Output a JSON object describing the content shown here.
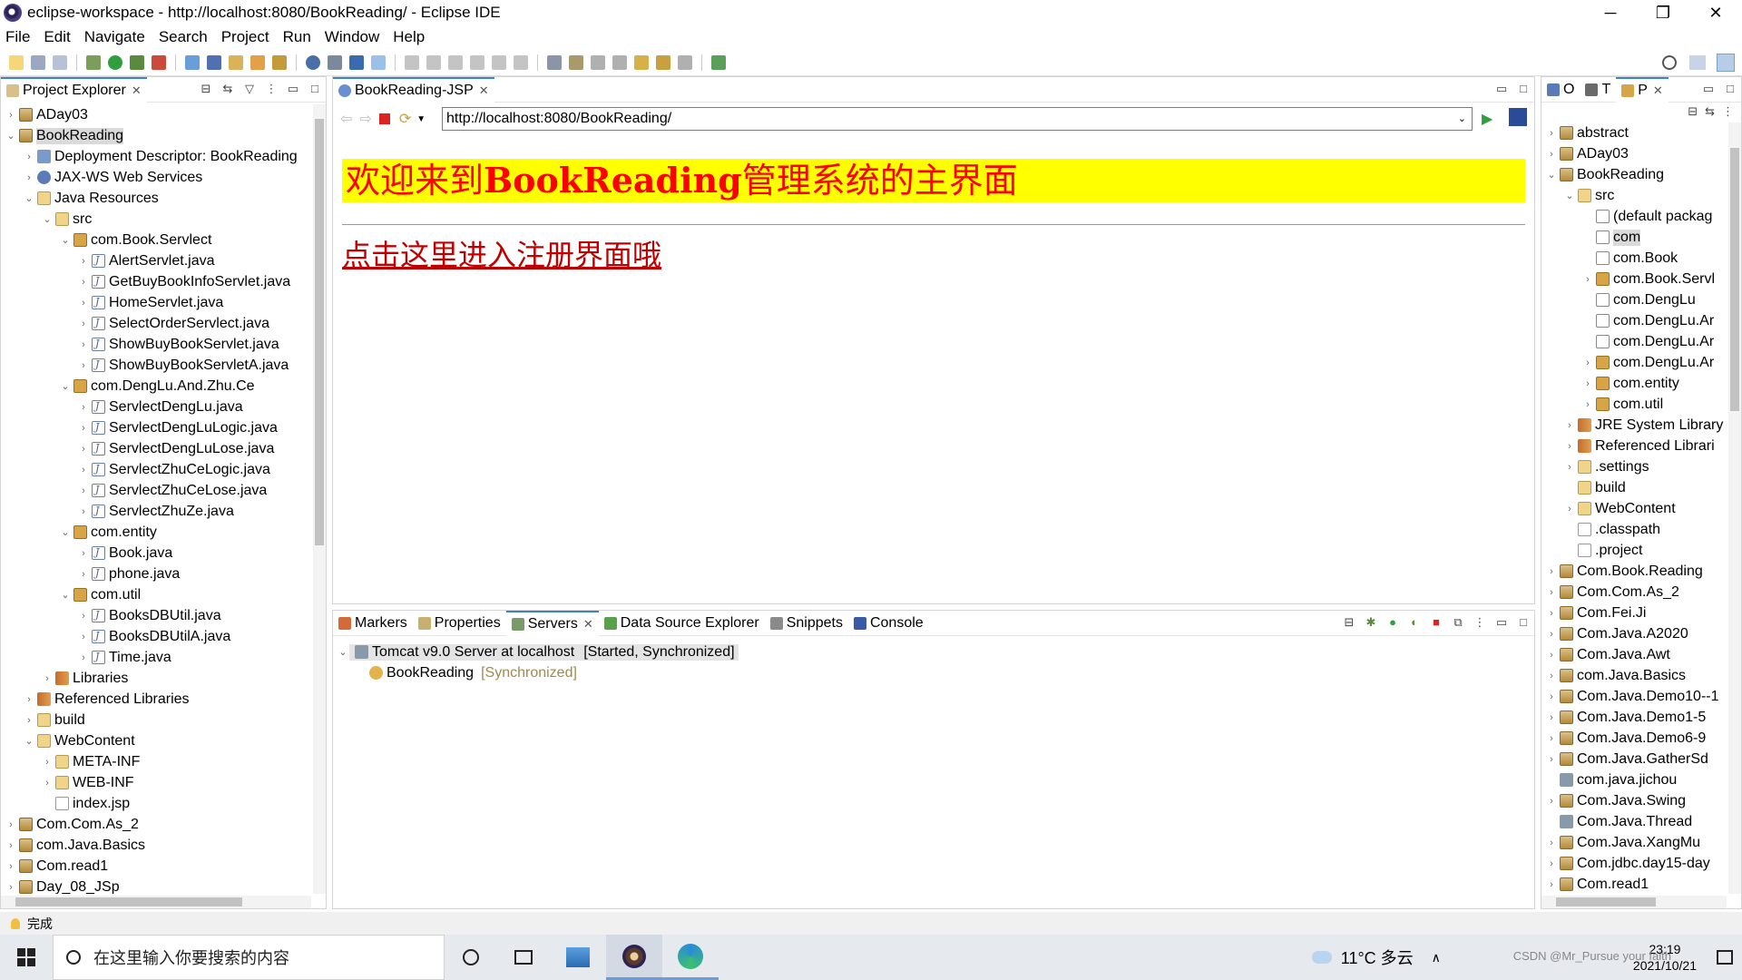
{
  "window": {
    "title": "eclipse-workspace - http://localhost:8080/BookReading/ - Eclipse IDE",
    "minimize": "─",
    "restore": "❐",
    "close": "✕"
  },
  "menu": [
    "File",
    "Edit",
    "Navigate",
    "Search",
    "Project",
    "Run",
    "Window",
    "Help"
  ],
  "project_explorer": {
    "tab_label": "Project Explorer",
    "rows": [
      {
        "label": "ADay03",
        "depth": 0,
        "tw": "›",
        "icon": "proj"
      },
      {
        "label": "BookReading",
        "depth": 0,
        "tw": "⌄",
        "icon": "proj",
        "sel": true
      },
      {
        "label": "Deployment Descriptor: BookReading",
        "depth": 1,
        "tw": "›",
        "icon": "dd"
      },
      {
        "label": "JAX-WS Web Services",
        "depth": 1,
        "tw": "›",
        "icon": "ws"
      },
      {
        "label": "Java Resources",
        "depth": 1,
        "tw": "⌄",
        "icon": "folder"
      },
      {
        "label": "src",
        "depth": 2,
        "tw": "⌄",
        "icon": "folder"
      },
      {
        "label": "com.Book.Servlect",
        "depth": 3,
        "tw": "⌄",
        "icon": "pkg"
      },
      {
        "label": "AlertServlet.java",
        "depth": 4,
        "tw": "›",
        "icon": "java"
      },
      {
        "label": "GetBuyBookInfoServlet.java",
        "depth": 4,
        "tw": "›",
        "icon": "java"
      },
      {
        "label": "HomeServlet.java",
        "depth": 4,
        "tw": "›",
        "icon": "java"
      },
      {
        "label": "SelectOrderServlect.java",
        "depth": 4,
        "tw": "›",
        "icon": "java"
      },
      {
        "label": "ShowBuyBookServlet.java",
        "depth": 4,
        "tw": "›",
        "icon": "java"
      },
      {
        "label": "ShowBuyBookServletA.java",
        "depth": 4,
        "tw": "›",
        "icon": "java"
      },
      {
        "label": "com.DengLu.And.Zhu.Ce",
        "depth": 3,
        "tw": "⌄",
        "icon": "pkg"
      },
      {
        "label": "ServlectDengLu.java",
        "depth": 4,
        "tw": "›",
        "icon": "java"
      },
      {
        "label": "ServlectDengLuLogic.java",
        "depth": 4,
        "tw": "›",
        "icon": "java"
      },
      {
        "label": "ServlectDengLuLose.java",
        "depth": 4,
        "tw": "›",
        "icon": "java"
      },
      {
        "label": "ServlectZhuCeLogic.java",
        "depth": 4,
        "tw": "›",
        "icon": "java"
      },
      {
        "label": "ServlectZhuCeLose.java",
        "depth": 4,
        "tw": "›",
        "icon": "java"
      },
      {
        "label": "ServlectZhuZe.java",
        "depth": 4,
        "tw": "›",
        "icon": "java"
      },
      {
        "label": "com.entity",
        "depth": 3,
        "tw": "⌄",
        "icon": "pkg"
      },
      {
        "label": "Book.java",
        "depth": 4,
        "tw": "›",
        "icon": "java"
      },
      {
        "label": "phone.java",
        "depth": 4,
        "tw": "›",
        "icon": "java"
      },
      {
        "label": "com.util",
        "depth": 3,
        "tw": "⌄",
        "icon": "pkg"
      },
      {
        "label": "BooksDBUtil.java",
        "depth": 4,
        "tw": "›",
        "icon": "java"
      },
      {
        "label": "BooksDBUtilA.java",
        "depth": 4,
        "tw": "›",
        "icon": "java"
      },
      {
        "label": "Time.java",
        "depth": 4,
        "tw": "›",
        "icon": "java"
      },
      {
        "label": "Libraries",
        "depth": 2,
        "tw": "›",
        "icon": "lib"
      },
      {
        "label": "Referenced Libraries",
        "depth": 1,
        "tw": "›",
        "icon": "lib"
      },
      {
        "label": "build",
        "depth": 1,
        "tw": "›",
        "icon": "folder"
      },
      {
        "label": "WebContent",
        "depth": 1,
        "tw": "⌄",
        "icon": "folder"
      },
      {
        "label": "META-INF",
        "depth": 2,
        "tw": "›",
        "icon": "folder"
      },
      {
        "label": "WEB-INF",
        "depth": 2,
        "tw": "›",
        "icon": "folder"
      },
      {
        "label": "index.jsp",
        "depth": 2,
        "tw": "",
        "icon": "file"
      },
      {
        "label": "Com.Com.As_2",
        "depth": 0,
        "tw": "›",
        "icon": "proj"
      },
      {
        "label": "com.Java.Basics",
        "depth": 0,
        "tw": "›",
        "icon": "proj"
      },
      {
        "label": "Com.read1",
        "depth": 0,
        "tw": "›",
        "icon": "proj"
      },
      {
        "label": "Day_08_JSp",
        "depth": 0,
        "tw": "›",
        "icon": "proj"
      }
    ]
  },
  "browser": {
    "tab_label": "BookReading-JSP",
    "url": "http://localhost:8080/BookReading/",
    "welcome_prefix": "欢迎来到",
    "welcome_bold": "BookReading",
    "welcome_suffix": "管理系统的主界面",
    "register_link": "点击这里进入注册界面哦"
  },
  "bottom_panel": {
    "tabs": [
      "Markers",
      "Properties",
      "Servers",
      "Data Source Explorer",
      "Snippets",
      "Console"
    ],
    "server_name": "Tomcat v9.0 Server at localhost",
    "server_status": "[Started, Synchronized]",
    "module_name": "BookReading",
    "module_status": "[Synchronized]"
  },
  "right_panel": {
    "tabs": [
      "O",
      "T",
      "P"
    ],
    "rows": [
      {
        "label": "abstract",
        "depth": 0,
        "tw": "›",
        "icon": "proj"
      },
      {
        "label": "ADay03",
        "depth": 0,
        "tw": "›",
        "icon": "proj"
      },
      {
        "label": "BookReading",
        "depth": 0,
        "tw": "⌄",
        "icon": "proj"
      },
      {
        "label": "src",
        "depth": 1,
        "tw": "⌄",
        "icon": "folder"
      },
      {
        "label": "(default packag",
        "depth": 2,
        "tw": "",
        "icon": "pkgempty"
      },
      {
        "label": "com",
        "depth": 2,
        "tw": "",
        "icon": "pkgempty",
        "sel": true
      },
      {
        "label": "com.Book",
        "depth": 2,
        "tw": "",
        "icon": "pkgempty"
      },
      {
        "label": "com.Book.Servl",
        "depth": 2,
        "tw": "›",
        "icon": "pkg"
      },
      {
        "label": "com.DengLu",
        "depth": 2,
        "tw": "",
        "icon": "pkgempty"
      },
      {
        "label": "com.DengLu.Ar",
        "depth": 2,
        "tw": "",
        "icon": "pkgempty"
      },
      {
        "label": "com.DengLu.Ar",
        "depth": 2,
        "tw": "",
        "icon": "pkgempty"
      },
      {
        "label": "com.DengLu.Ar",
        "depth": 2,
        "tw": "›",
        "icon": "pkg"
      },
      {
        "label": "com.entity",
        "depth": 2,
        "tw": "›",
        "icon": "pkg"
      },
      {
        "label": "com.util",
        "depth": 2,
        "tw": "›",
        "icon": "pkg"
      },
      {
        "label": "JRE System Library",
        "depth": 1,
        "tw": "›",
        "icon": "lib"
      },
      {
        "label": "Referenced Librari",
        "depth": 1,
        "tw": "›",
        "icon": "lib"
      },
      {
        "label": ".settings",
        "depth": 1,
        "tw": "›",
        "icon": "folder"
      },
      {
        "label": "build",
        "depth": 1,
        "tw": "",
        "icon": "folder"
      },
      {
        "label": "WebContent",
        "depth": 1,
        "tw": "›",
        "icon": "folder"
      },
      {
        "label": ".classpath",
        "depth": 1,
        "tw": "",
        "icon": "file"
      },
      {
        "label": ".project",
        "depth": 1,
        "tw": "",
        "icon": "file"
      },
      {
        "label": "Com.Book.Reading",
        "depth": 0,
        "tw": "›",
        "icon": "proj"
      },
      {
        "label": "Com.Com.As_2",
        "depth": 0,
        "tw": "›",
        "icon": "proj"
      },
      {
        "label": "Com.Fei.Ji",
        "depth": 0,
        "tw": "›",
        "icon": "proj"
      },
      {
        "label": "Com.Java.A2020",
        "depth": 0,
        "tw": "›",
        "icon": "proj"
      },
      {
        "label": "Com.Java.Awt",
        "depth": 0,
        "tw": "›",
        "icon": "proj"
      },
      {
        "label": "com.Java.Basics",
        "depth": 0,
        "tw": "›",
        "icon": "proj"
      },
      {
        "label": "Com.Java.Demo10--1",
        "depth": 0,
        "tw": "›",
        "icon": "proj"
      },
      {
        "label": "Com.Java.Demo1-5",
        "depth": 0,
        "tw": "›",
        "icon": "proj"
      },
      {
        "label": "Com.Java.Demo6-9",
        "depth": 0,
        "tw": "›",
        "icon": "proj"
      },
      {
        "label": "Com.Java.GatherSd",
        "depth": 0,
        "tw": "›",
        "icon": "proj"
      },
      {
        "label": "com.java.jichou",
        "depth": 0,
        "tw": "",
        "icon": "server"
      },
      {
        "label": "Com.Java.Swing",
        "depth": 0,
        "tw": "›",
        "icon": "proj"
      },
      {
        "label": "Com.Java.Thread",
        "depth": 0,
        "tw": "",
        "icon": "server"
      },
      {
        "label": "Com.Java.XangMu",
        "depth": 0,
        "tw": "›",
        "icon": "proj"
      },
      {
        "label": "Com.jdbc.day15-day",
        "depth": 0,
        "tw": "›",
        "icon": "proj"
      },
      {
        "label": "Com.read1",
        "depth": 0,
        "tw": "›",
        "icon": "proj"
      }
    ]
  },
  "status": {
    "text": "完成"
  },
  "taskbar": {
    "search_placeholder": "在这里输入你要搜索的内容",
    "weather": "11°C 多云",
    "time": "23:19",
    "date": "2021/10/21",
    "watermark": "CSDN @Mr_Pursue your faith"
  }
}
